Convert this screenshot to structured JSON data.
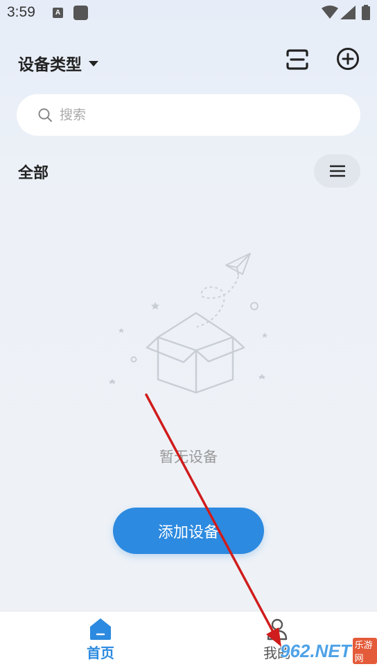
{
  "status_bar": {
    "time": "3:59",
    "notification_icon_letter": "A",
    "icons": [
      "a-notification-icon",
      "app-square-icon",
      "wifi-icon",
      "signal-icon",
      "battery-icon"
    ]
  },
  "header": {
    "title": "设备类型",
    "dropdown_icon": "caret-down-icon",
    "scan_icon": "scan-icon",
    "add_icon": "plus-circle-icon"
  },
  "search": {
    "placeholder": "搜索",
    "value": ""
  },
  "section": {
    "title": "全部",
    "menu_icon": "hamburger-menu-icon"
  },
  "empty_state": {
    "illustration": "empty-box-paper-plane",
    "message": "暂无设备"
  },
  "primary_action": {
    "label": "添加设备"
  },
  "bottom_nav": {
    "items": [
      {
        "label": "首页",
        "icon": "home-icon",
        "active": true
      },
      {
        "label": "我的",
        "icon": "user-icon",
        "active": false
      }
    ]
  },
  "watermark": {
    "text": "962.NET",
    "sub": "乐游网"
  },
  "colors": {
    "accent": "#2c8ae0",
    "background": "#eef2f7",
    "annotation_arrow": "#d01c1c"
  }
}
